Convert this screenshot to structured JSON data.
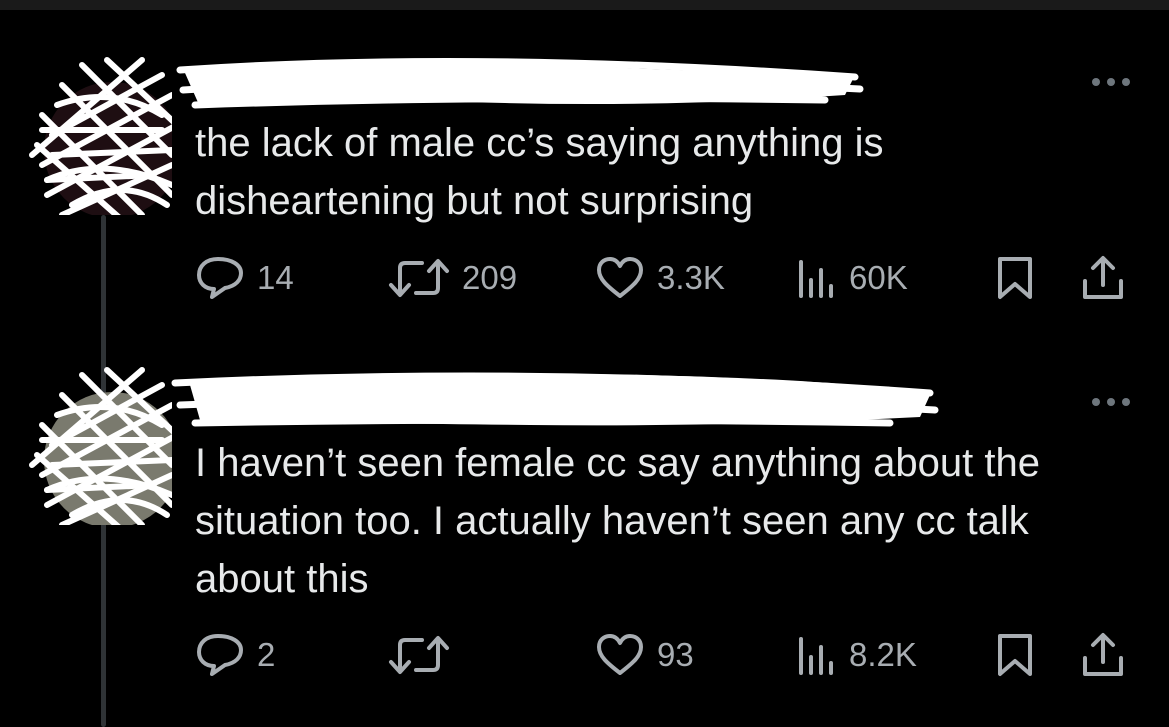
{
  "tweets": [
    {
      "text": "the lack of male cc’s saying anything is disheartening but not surprising",
      "replies": "14",
      "reposts": "209",
      "likes": "3.3K",
      "views": "60K"
    },
    {
      "text": "I haven’t seen female cc say anything about the situation too. I actually haven’t seen any cc talk about this",
      "replies": "2",
      "reposts": "",
      "likes": "93",
      "views": "8.2K"
    }
  ],
  "icons": {
    "reply": "speech-bubble-icon",
    "repost": "repost-arrows-icon",
    "like": "heart-icon",
    "views": "bar-chart-icon",
    "bookmark": "bookmark-icon",
    "share": "share-upload-icon",
    "more": "more-dots-icon"
  },
  "colors": {
    "background": "#000000",
    "text": "#e7e9ea",
    "secondary": "#a8adb2",
    "thread_line": "#2f3336",
    "redaction": "#ffffff"
  }
}
